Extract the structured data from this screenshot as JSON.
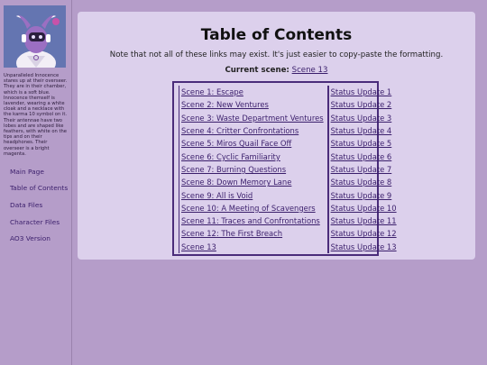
{
  "sidebar": {
    "avatar_alt": "Unparalleled Innocence avatar",
    "caption": "Unparalleled Innocence stares up at their overseer. They are in their chamber, which is a soft blue. Innocence themself is lavender, wearing a white cloak and a necklace with the karma 10 symbol on it. Their antennae have two lobes and are shaped like feathers, with white on the tips and on their headphones. Their overseer is a bright magenta.",
    "nav": [
      "Main Page",
      "Table of Contents",
      "Data Files",
      "Character Files",
      "AO3 Version"
    ]
  },
  "main": {
    "title": "Table of Contents",
    "note": "Note that not all of these links may exist. It's just easier to copy-paste the formatting.",
    "current_label": "Current scene:",
    "current_link": "Scene 13"
  },
  "toc": [
    {
      "scene": "Scene 1: Escape",
      "status": "Status Update 1"
    },
    {
      "scene": "Scene 2: New Ventures",
      "status": "Status Update 2"
    },
    {
      "scene": "Scene 3: Waste Department Ventures",
      "status": "Status Update 3"
    },
    {
      "scene": "Scene 4: Critter Confrontations",
      "status": "Status Update 4"
    },
    {
      "scene": "Scene 5: Miros Quail Face Off",
      "status": "Status Update 5"
    },
    {
      "scene": "Scene 6: Cyclic Familiarity",
      "status": "Status Update 6"
    },
    {
      "scene": "Scene 7: Burning Questions",
      "status": "Status Update 7"
    },
    {
      "scene": "Scene 8: Down Memory Lane",
      "status": "Status Update 8"
    },
    {
      "scene": "Scene 9: All is Void",
      "status": "Status Update 9"
    },
    {
      "scene": "Scene 10: A Meeting of Scavengers",
      "status": "Status Update 10"
    },
    {
      "scene": "Scene 11: Traces and Confrontations",
      "status": "Status Update 11"
    },
    {
      "scene": "Scene 12: The First Breach",
      "status": "Status Update 12"
    },
    {
      "scene": "Scene 13",
      "status": "Status Update 13"
    }
  ],
  "colors": {
    "background": "#b59dc9",
    "panel": "#dcd0ec",
    "link": "#3a1e6b",
    "table_border": "#4a2c7a"
  }
}
